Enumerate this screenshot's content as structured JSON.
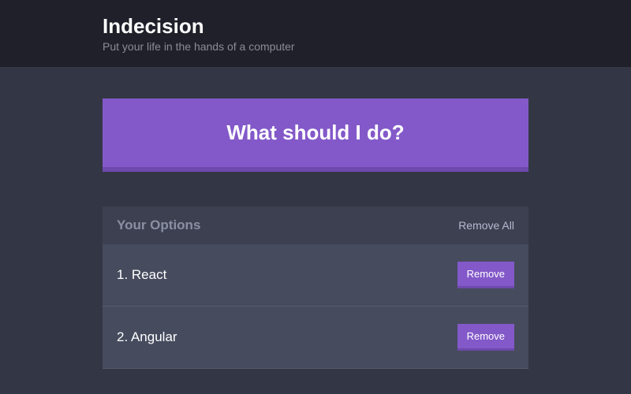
{
  "header": {
    "title": "Indecision",
    "subtitle": "Put your life in the hands of a computer"
  },
  "action_button": {
    "label": "What should I do?"
  },
  "options_widget": {
    "title": "Your Options",
    "remove_all_label": "Remove All",
    "remove_label": "Remove",
    "items": [
      {
        "text": "1. React"
      },
      {
        "text": "2. Angular"
      }
    ]
  },
  "colors": {
    "accent": "#8359c9",
    "accent_dark": "#6e49ad",
    "bg": "#333745",
    "header_bg": "#1f2029",
    "widget_bg": "#464b5e",
    "widget_header_bg": "#3c4050"
  }
}
